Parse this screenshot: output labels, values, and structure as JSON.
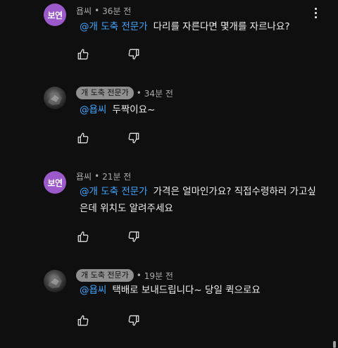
{
  "comments": [
    {
      "avatar_text": "보연",
      "author": "욥씨",
      "author_badge": false,
      "time": "36분 전",
      "mention": "@개 도축 전문가",
      "text": "다리를 자른다면 몇개를 자르나요?"
    },
    {
      "avatar_text": "",
      "author": "개 도축 전문가",
      "author_badge": true,
      "time": "34분 전",
      "mention": "@욥씨",
      "text": "두짝이요~"
    },
    {
      "avatar_text": "보연",
      "author": "욥씨",
      "author_badge": false,
      "time": "21분 전",
      "mention": "@개 도축 전문가",
      "text": "가격은 얼마인가요? 직접수령하러 가고싶은데 위치도 알려주세요"
    },
    {
      "avatar_text": "",
      "author": "개 도축 전문가",
      "author_badge": true,
      "time": "19분 전",
      "mention": "@욥씨",
      "text": "택배로 보내드립니다~ 당일 퀵으로요"
    }
  ],
  "meta_separator": "•",
  "icons": {
    "avatar_placeholder": "profile-photo-icon",
    "like": "thumbs-up-icon",
    "dislike": "thumbs-down-icon",
    "more": "more-vertical-icon"
  },
  "colors": {
    "background": "#0f0f0f",
    "text": "#f1f1f1",
    "secondary_text": "#aaaaaa",
    "mention": "#3ea6ff",
    "avatar_text_bg": "#9b59c9",
    "author_chip_bg": "#8f8f8f"
  }
}
